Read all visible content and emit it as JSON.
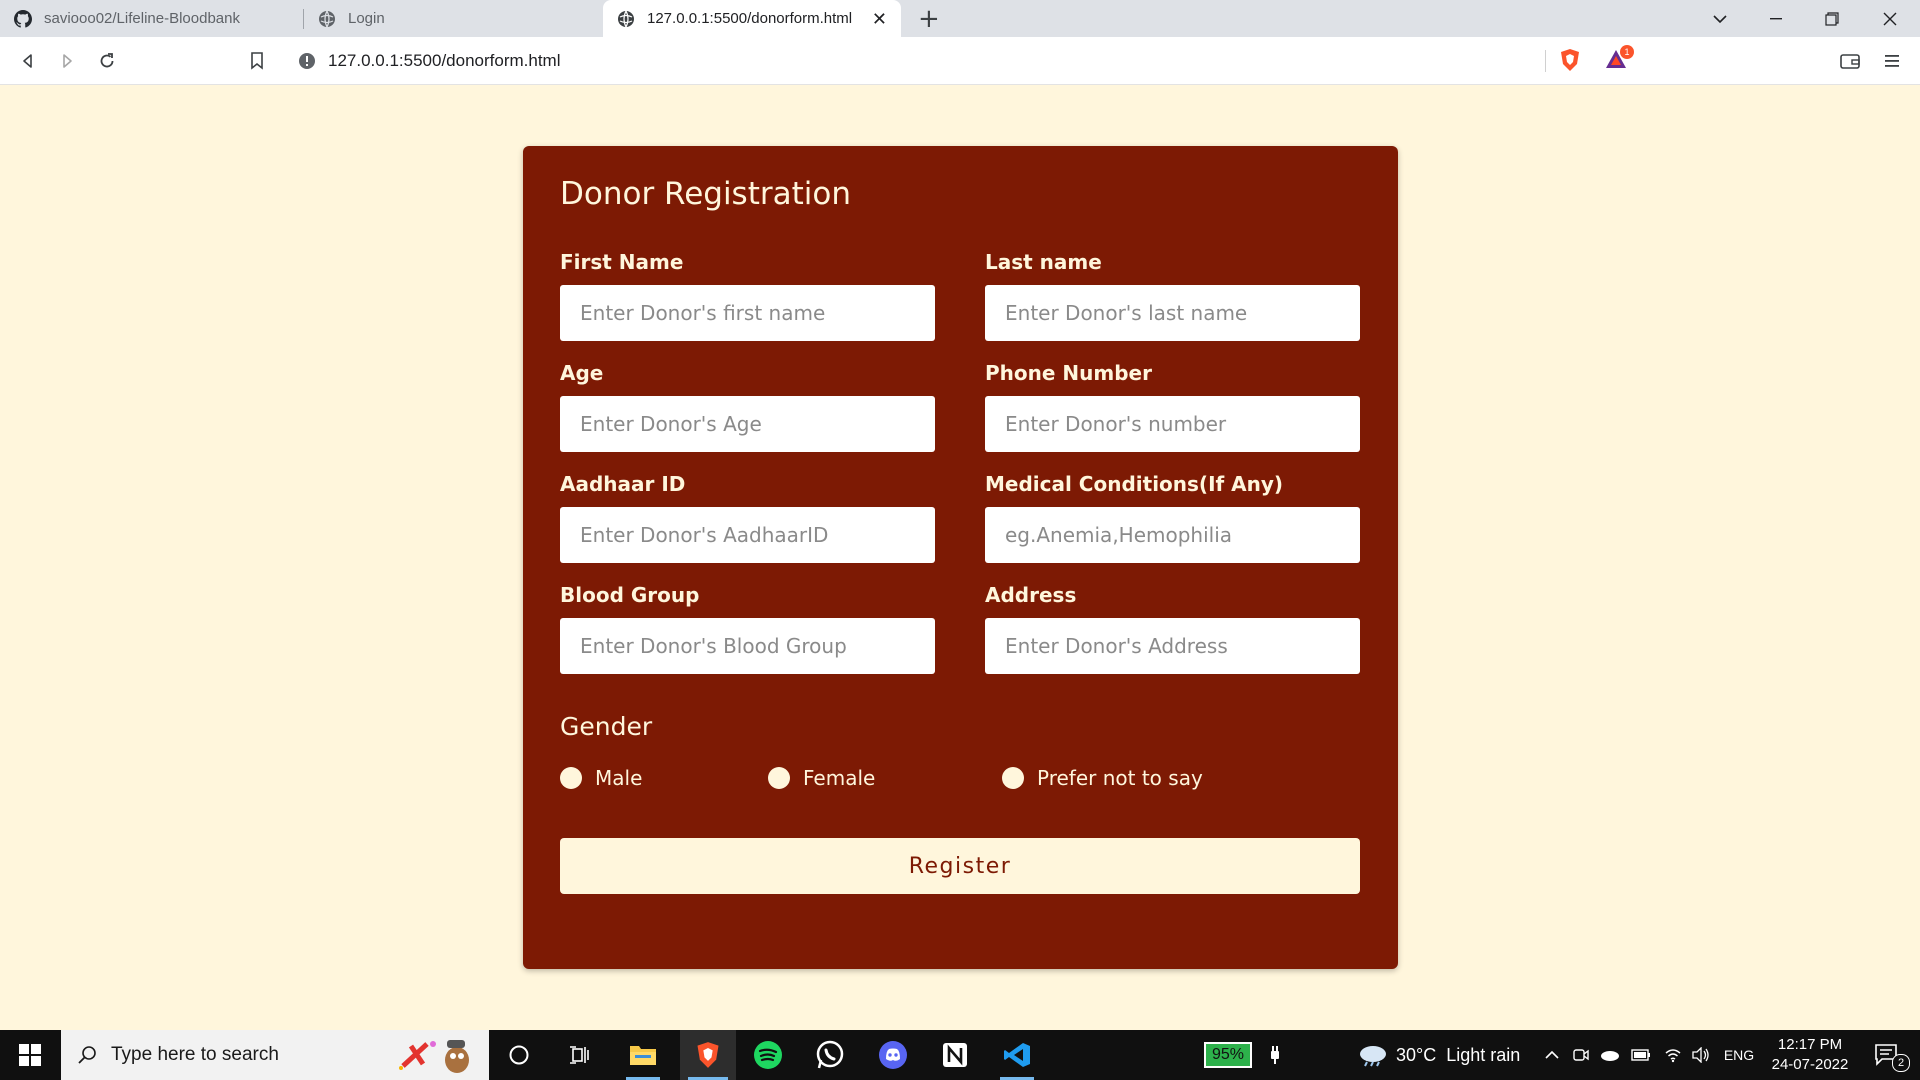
{
  "browser": {
    "tabs": [
      {
        "title": "saviooo02/Lifeline-Bloodbank",
        "icon": "github-icon",
        "active": false
      },
      {
        "title": "Login",
        "icon": "globe-icon",
        "active": false
      },
      {
        "title": "127.0.0.1:5500/donorform.html",
        "icon": "globe-icon",
        "active": true
      }
    ],
    "url": "127.0.0.1:5500/donorform.html",
    "shield_badge": "1"
  },
  "form": {
    "title": "Donor Registration",
    "fields": [
      {
        "label": "First Name",
        "placeholder": "Enter Donor's first name"
      },
      {
        "label": "Last name",
        "placeholder": "Enter Donor's last name"
      },
      {
        "label": "Age",
        "placeholder": "Enter Donor's Age"
      },
      {
        "label": "Phone Number",
        "placeholder": "Enter Donor's number"
      },
      {
        "label": "Aadhaar ID",
        "placeholder": "Enter Donor's AadhaarID"
      },
      {
        "label": "Medical Conditions(If Any)",
        "placeholder": "eg.Anemia,Hemophilia"
      },
      {
        "label": "Blood Group",
        "placeholder": "Enter Donor's Blood Group"
      },
      {
        "label": "Address",
        "placeholder": "Enter Donor's Address"
      }
    ],
    "gender_title": "Gender",
    "gender_options": [
      "Male",
      "Female",
      "Prefer not to say"
    ],
    "submit_label": "Register"
  },
  "taskbar": {
    "search_placeholder": "Type here to search",
    "battery": "95%",
    "weather": "30°C  Light rain",
    "language": "ENG",
    "time": "12:17 PM",
    "date": "24-07-2022",
    "notification_count": "2"
  },
  "colors": {
    "page_bg": "#fff6dc",
    "card_bg": "#7d1a04",
    "accent": "#fff6dc"
  }
}
